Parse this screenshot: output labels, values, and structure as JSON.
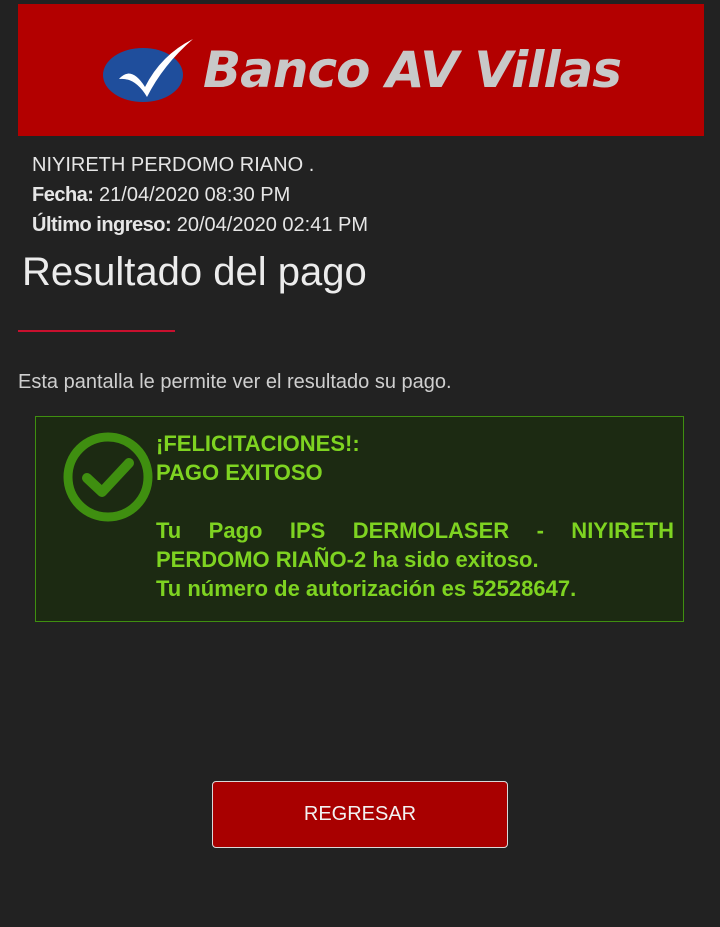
{
  "bank": {
    "name": "Banco AV Villas",
    "banner_color": "#b30000"
  },
  "user": {
    "name": "NIYIRETH PERDOMO RIANO  .",
    "date_label": "Fecha:",
    "date_value": "21/04/2020 08:30 PM",
    "last_login_label": "Último ingreso:",
    "last_login_value": "20/04/2020 02:41 PM"
  },
  "page": {
    "title": "Resultado del pago",
    "description": "Esta pantalla le permite ver el resultado su pago."
  },
  "result": {
    "status_icon": "checkmark-circle-icon",
    "headline": "¡FELICITACIONES!:",
    "status": "PAGO EXITOSO",
    "detail_line1": "Tu Pago IPS DERMOLASER - NIYIRETH PERDOMO RIAÑO-2 ha sido exitoso.",
    "detail_line2": "Tu número de autorización es 52528647.",
    "accent_color": "#7ed321"
  },
  "actions": {
    "back_label": "REGRESAR"
  }
}
